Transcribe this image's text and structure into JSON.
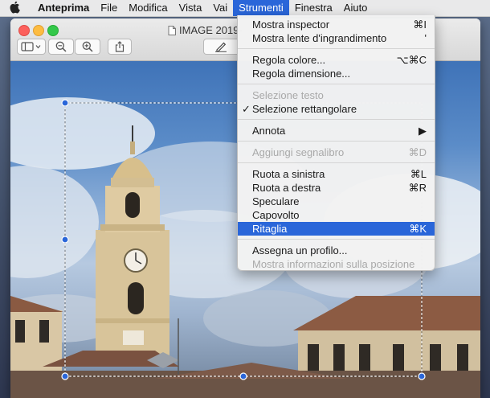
{
  "menubar": {
    "app": "Anteprima",
    "items": [
      "File",
      "Modifica",
      "Vista",
      "Vai",
      "Strumenti",
      "Finestra",
      "Aiuto"
    ],
    "active": "Strumenti"
  },
  "window": {
    "title": "IMAGE 2019-"
  },
  "menu": {
    "groups": [
      [
        {
          "label": "Mostra inspector",
          "shortcut": "⌘I"
        },
        {
          "label": "Mostra lente d'ingrandimento",
          "shortcut": "'"
        }
      ],
      [
        {
          "label": "Regola colore...",
          "shortcut": "⌥⌘C"
        },
        {
          "label": "Regola dimensione...",
          "shortcut": ""
        }
      ],
      [
        {
          "label": "Selezione testo",
          "shortcut": "",
          "disabled": true
        },
        {
          "label": "Selezione rettangolare",
          "shortcut": "",
          "checked": true
        }
      ],
      [
        {
          "label": "Annota",
          "shortcut": "▶"
        }
      ],
      [
        {
          "label": "Aggiungi segnalibro",
          "shortcut": "⌘D",
          "disabled": true
        }
      ],
      [
        {
          "label": "Ruota a sinistra",
          "shortcut": "⌘L"
        },
        {
          "label": "Ruota a destra",
          "shortcut": "⌘R"
        },
        {
          "label": "Speculare",
          "shortcut": ""
        },
        {
          "label": "Capovolto",
          "shortcut": ""
        },
        {
          "label": "Ritaglia",
          "shortcut": "⌘K",
          "highlighted": true
        }
      ],
      [
        {
          "label": "Assegna un profilo...",
          "shortcut": ""
        },
        {
          "label": "Mostra informazioni sulla posizione",
          "shortcut": "",
          "disabled": true
        }
      ]
    ],
    "check_glyph": "✓"
  },
  "colors": {
    "menu_highlight": "#2a66d9",
    "disabled_text": "#a9a9a9"
  }
}
